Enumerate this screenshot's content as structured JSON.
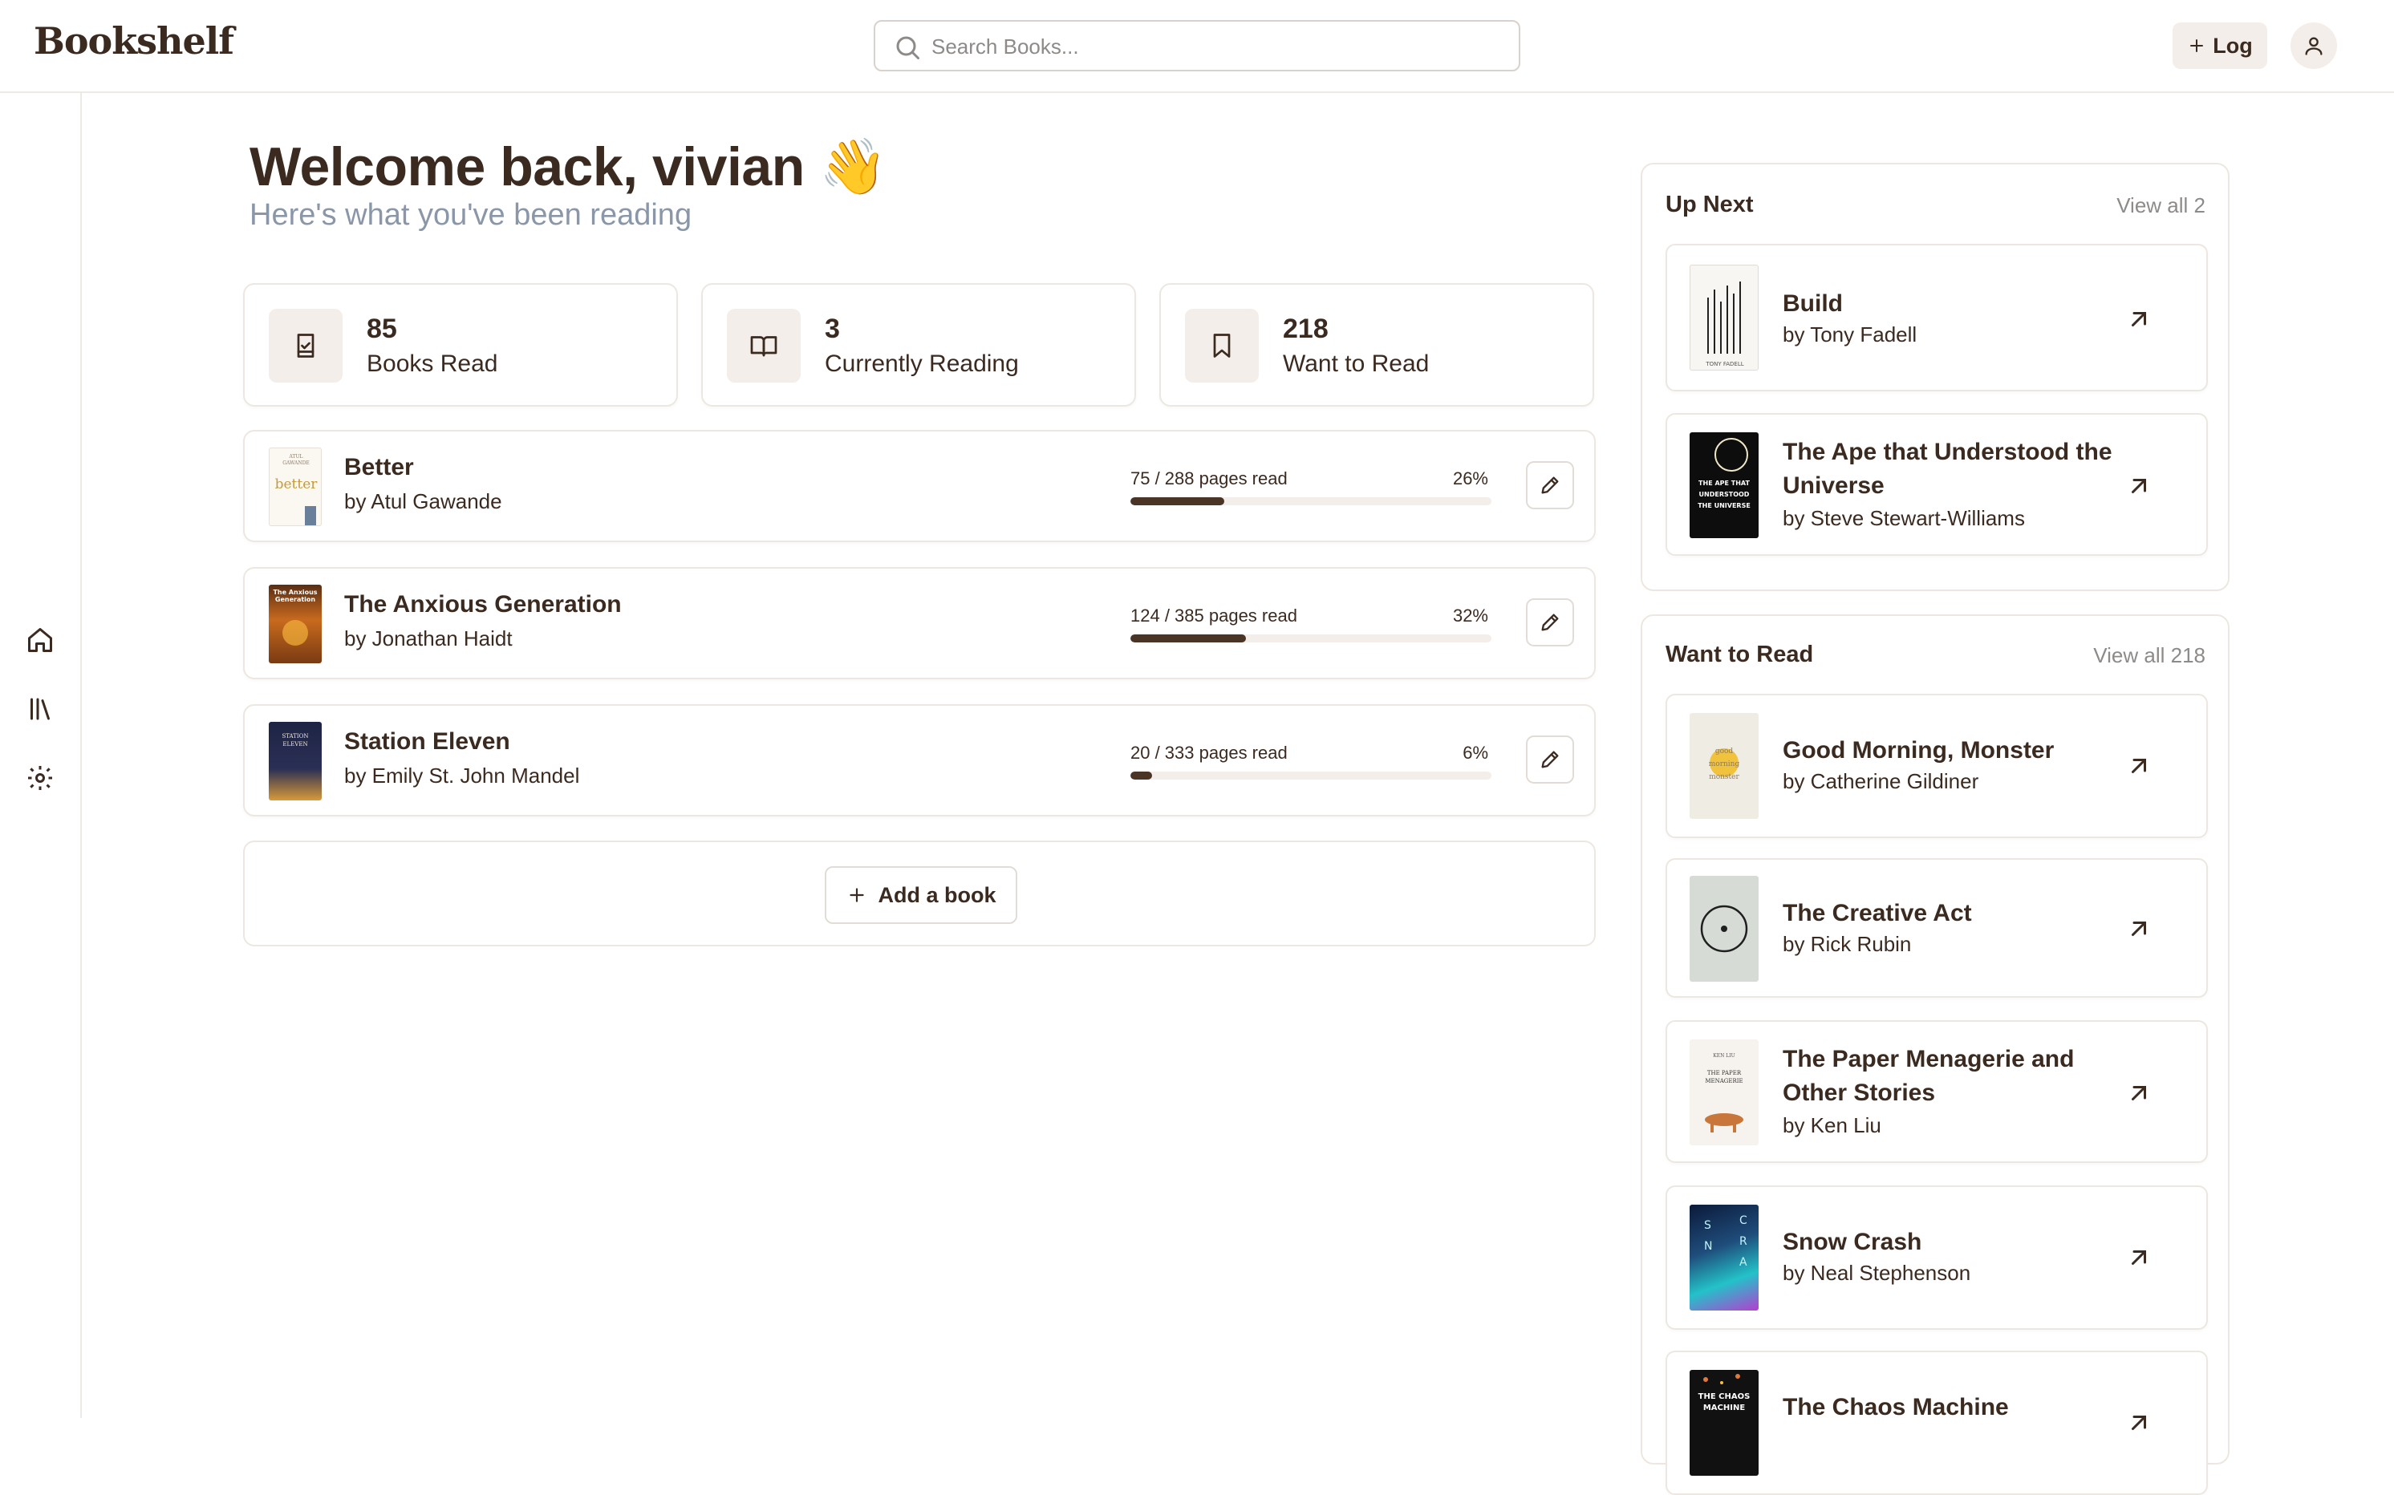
{
  "header": {
    "brand": "Bookshelf",
    "search_placeholder": "Search Books...",
    "log_label": "Log"
  },
  "main": {
    "welcome": "Welcome back, vivian 👋",
    "subtitle": "Here's what you've been reading",
    "stats": [
      {
        "value": "85",
        "label": "Books Read",
        "icon": "book-check-icon"
      },
      {
        "value": "3",
        "label": "Currently Reading",
        "icon": "open-book-icon"
      },
      {
        "value": "218",
        "label": "Want to Read",
        "icon": "bookmark-icon"
      }
    ],
    "currently_reading": [
      {
        "title": "Better",
        "author": "by Atul Gawande",
        "pages_text": "75 / 288 pages read",
        "percent_text": "26%",
        "progress": 26
      },
      {
        "title": "The Anxious Generation",
        "author": "by Jonathan Haidt",
        "pages_text": "124 / 385 pages read",
        "percent_text": "32%",
        "progress": 32
      },
      {
        "title": "Station Eleven",
        "author": "by Emily St. John Mandel",
        "pages_text": "20 / 333 pages read",
        "percent_text": "6%",
        "progress": 6
      }
    ],
    "add_book_label": "Add a book"
  },
  "up_next": {
    "title": "Up Next",
    "view_all": "View all 2",
    "items": [
      {
        "title": "Build",
        "author": "by Tony Fadell"
      },
      {
        "title": "The Ape that Understood the Universe",
        "author": "by Steve Stewart-Williams"
      }
    ]
  },
  "want_to_read": {
    "title": "Want to Read",
    "view_all": "View all 218",
    "items": [
      {
        "title": "Good Morning, Monster",
        "author": "by Catherine Gildiner"
      },
      {
        "title": "The Creative Act",
        "author": "by Rick Rubin"
      },
      {
        "title": "The Paper Menagerie and Other Stories",
        "author": "by Ken Liu"
      },
      {
        "title": "Snow Crash",
        "author": "by Neal Stephenson"
      },
      {
        "title": "The Chaos Machine",
        "author": ""
      }
    ]
  },
  "colors": {
    "text": "#3b2a1f",
    "muted": "#8a97a8",
    "progress_fill": "#4a3426",
    "progress_track": "#f3eee9",
    "chip_bg": "#f3eee9",
    "border": "#ede7e1"
  }
}
